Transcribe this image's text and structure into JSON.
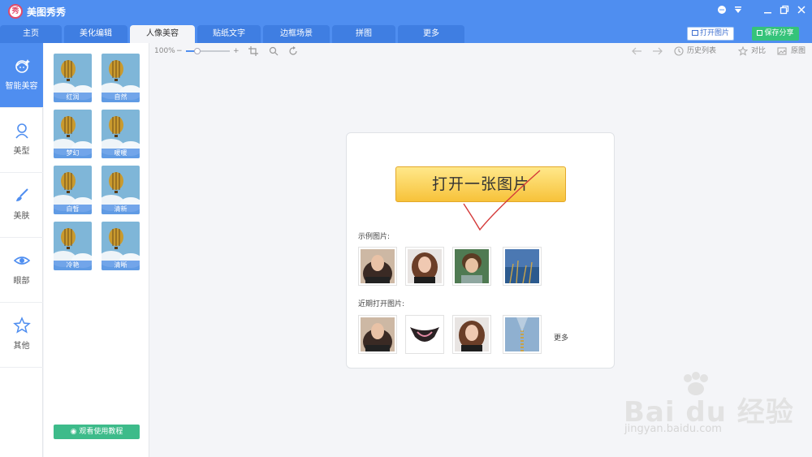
{
  "app": {
    "title": "美图秀秀",
    "logo_glyph": "秀"
  },
  "window_controls": [
    "chat-icon",
    "dropdown-icon",
    "minimize-icon",
    "restore-icon",
    "close-icon"
  ],
  "tabs": [
    {
      "label": "主页"
    },
    {
      "label": "美化编辑"
    },
    {
      "label": "人像美容",
      "active": true
    },
    {
      "label": "贴纸文字"
    },
    {
      "label": "边框场景"
    },
    {
      "label": "拼图"
    },
    {
      "label": "更多"
    }
  ],
  "header_actions": {
    "open_image": "打开图片",
    "save_share": "保存分享"
  },
  "leftnav": [
    {
      "label": "智能美容",
      "icon": "smart-beauty-icon",
      "active": true
    },
    {
      "label": "美型",
      "icon": "face-shape-icon"
    },
    {
      "label": "美肤",
      "icon": "skin-brush-icon"
    },
    {
      "label": "眼部",
      "icon": "eye-icon"
    },
    {
      "label": "其他",
      "icon": "star-icon"
    }
  ],
  "effects": [
    "红润",
    "自然",
    "梦幻",
    "暖暖",
    "白皙",
    "清新",
    "冷艳",
    "清晰"
  ],
  "tutorial_button": "观看使用教程",
  "toolbar": {
    "zoom_level": "100%",
    "zoom_fraction": 0.25,
    "history_label": "历史列表",
    "compare_label": "对比",
    "original_label": "原图"
  },
  "card": {
    "open_button": "打开一张图片",
    "sample_label": "示例图片:",
    "recent_label": "近期打开图片:",
    "more_label": "更多",
    "samples": [
      "woman-portrait-photo",
      "woman-portrait-photo-2",
      "child-portrait-photo",
      "seaside-grass-photo"
    ],
    "recent": [
      "woman-portrait-photo",
      "garment-photo",
      "woman-portrait-photo-2",
      "zipper-texture-photo"
    ]
  },
  "watermark": {
    "brand": "Bai du 经验",
    "url": "jingyan.baidu.com"
  },
  "colors": {
    "primary_blue": "#4f8ef0",
    "save_green": "#35c37a",
    "button_yellow": "#f7c23a"
  }
}
